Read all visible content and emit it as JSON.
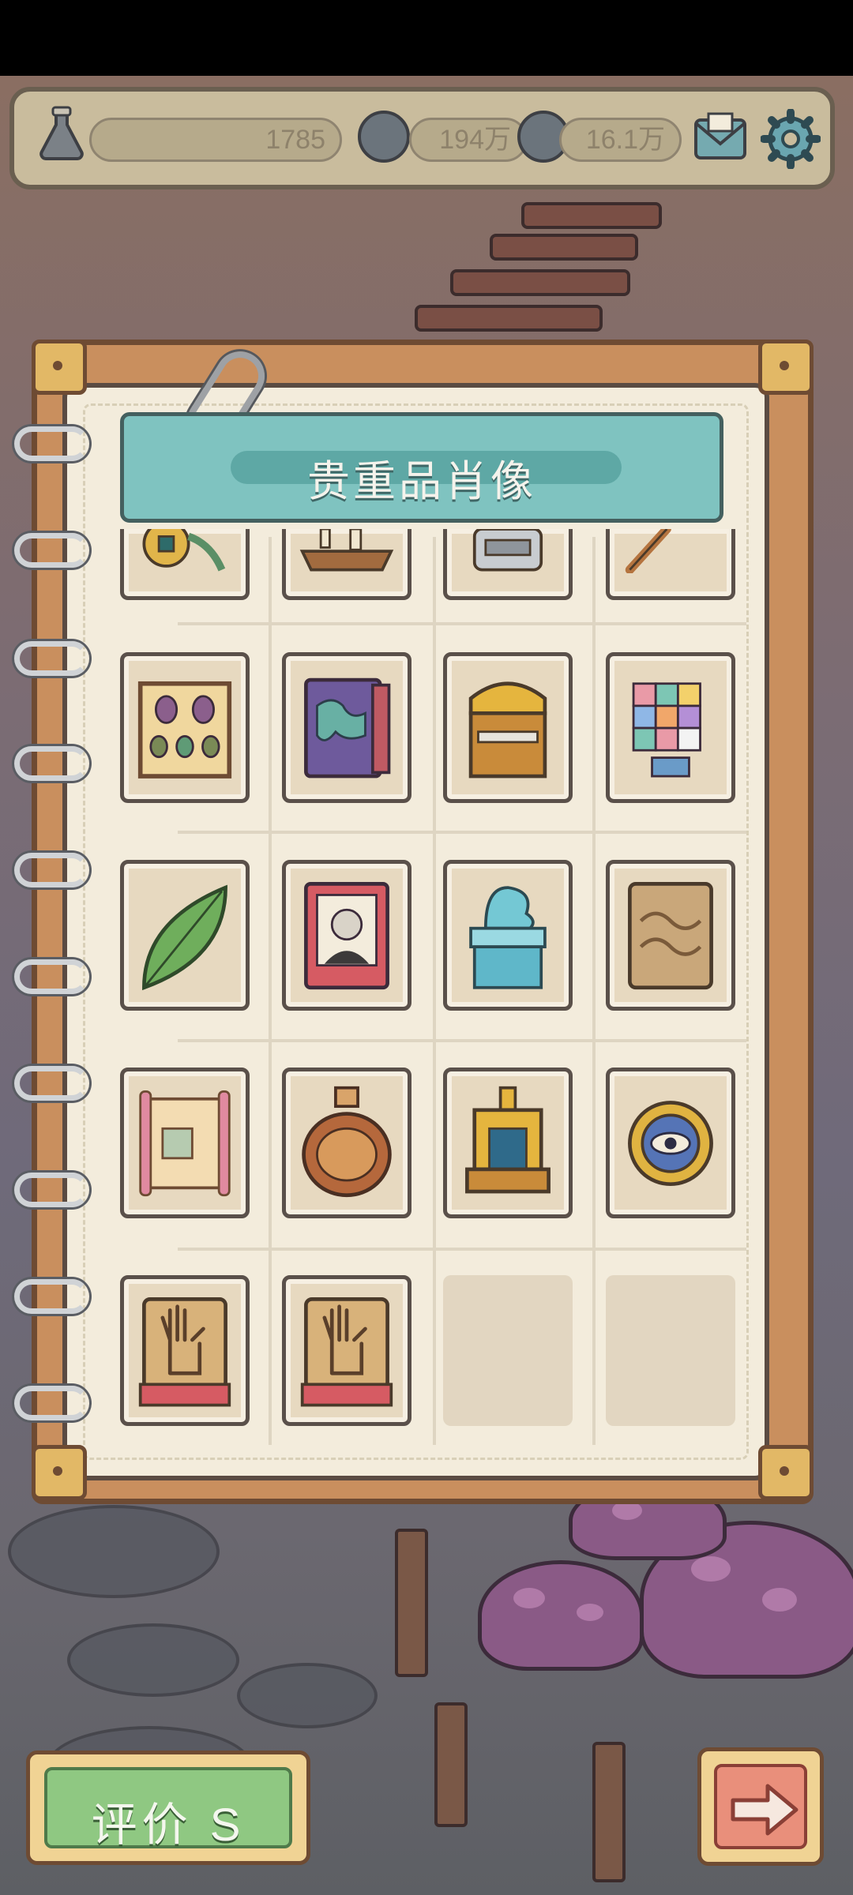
{
  "topbar": {
    "bottle_count": "1785",
    "bubble_count": "194万",
    "chat_count": "16.1万",
    "icons": [
      "bottle-icon",
      "speech-bubble-icon",
      "speech-bubble-dots-icon",
      "mail-icon",
      "gear-icon"
    ]
  },
  "notebook": {
    "title": "贵重品肖像",
    "items": [
      {
        "name": "coin-relic",
        "state": "partial"
      },
      {
        "name": "sailing-ship",
        "state": "partial"
      },
      {
        "name": "stone-statue",
        "state": "partial"
      },
      {
        "name": "wooden-tool",
        "state": "partial"
      },
      {
        "name": "beetle-specimen-frame",
        "state": "collected"
      },
      {
        "name": "world-map-book",
        "state": "collected"
      },
      {
        "name": "golden-treasure-chest",
        "state": "collected"
      },
      {
        "name": "color-cube-puzzle",
        "state": "collected"
      },
      {
        "name": "green-leaf",
        "state": "collected"
      },
      {
        "name": "portrait-book",
        "state": "collected"
      },
      {
        "name": "jade-dragon-seal",
        "state": "collected"
      },
      {
        "name": "stone-carving-tablet",
        "state": "collected"
      },
      {
        "name": "ancient-scroll",
        "state": "collected"
      },
      {
        "name": "pottery-vase",
        "state": "collected"
      },
      {
        "name": "golden-shrine",
        "state": "collected"
      },
      {
        "name": "eye-amulet",
        "state": "collected"
      },
      {
        "name": "handprint-tablet",
        "state": "collected"
      },
      {
        "name": "handprint-tablet",
        "state": "collected"
      },
      {
        "name": "empty-slot",
        "state": "empty"
      },
      {
        "name": "empty-slot",
        "state": "empty"
      }
    ]
  },
  "rating": {
    "label": "评价 S"
  },
  "colors": {
    "accent_teal": "#7fc3c0",
    "button_green": "#8fc882",
    "button_coral": "#e98f7b",
    "paper": "#f3ecdc"
  }
}
